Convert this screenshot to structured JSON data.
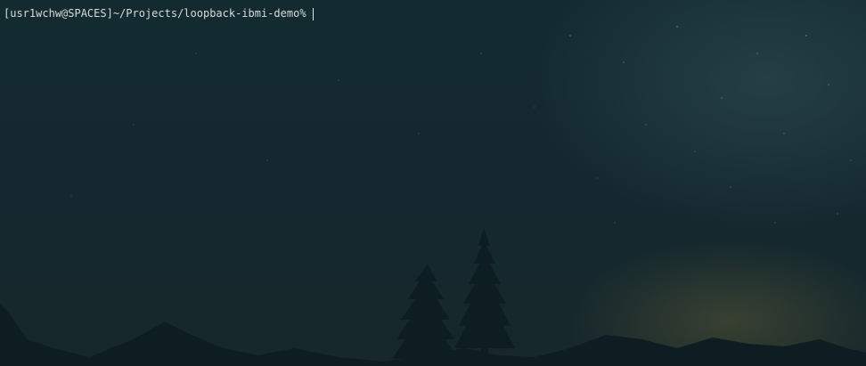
{
  "terminal": {
    "prompt": "[usr1wchw@SPACES]~/Projects/loopback-ibmi-demo%"
  },
  "colors": {
    "background": "#13272c",
    "text": "#d9dcd8",
    "silhouette": "#0d1d21"
  },
  "icons": {
    "cursor": "text-cursor-icon"
  }
}
